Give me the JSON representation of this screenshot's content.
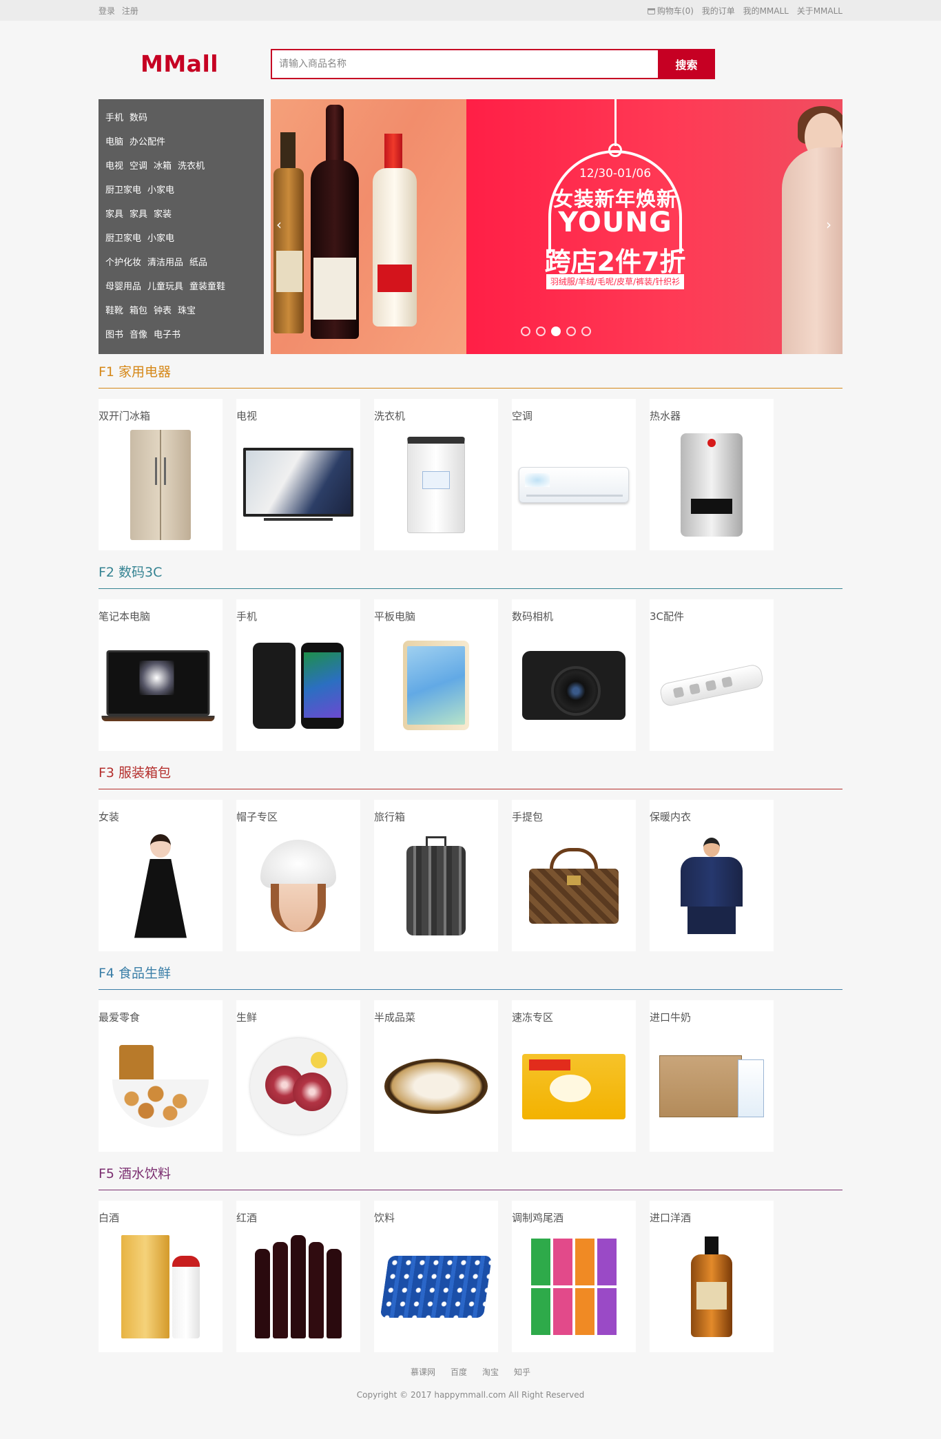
{
  "topnav": {
    "login": "登录",
    "register": "注册",
    "cart": "购物车(0)",
    "orders": "我的订单",
    "my_mmall": "我的MMALL",
    "about": "关于MMALL"
  },
  "header": {
    "logo": "MMall",
    "search_placeholder": "请输入商品名称",
    "search_button": "搜索"
  },
  "keywords": [
    [
      "手机",
      "数码"
    ],
    [
      "电脑",
      "办公配件"
    ],
    [
      "电视",
      "空调",
      "冰箱",
      "洗衣机"
    ],
    [
      "厨卫家电",
      "小家电"
    ],
    [
      "家具",
      "家具",
      "家装"
    ],
    [
      "厨卫家电",
      "小家电"
    ],
    [
      "个护化妆",
      "清洁用品",
      "纸品"
    ],
    [
      "母婴用品",
      "儿童玩具",
      "童装童鞋"
    ],
    [
      "鞋靴",
      "箱包",
      "钟表",
      "珠宝"
    ],
    [
      "图书",
      "音像",
      "电子书"
    ]
  ],
  "banner": {
    "date": "12/30-01/06",
    "line1": "女装新年焕新",
    "line2": "YOUNG",
    "line3": "跨店2件7折",
    "line4": "羽绒服/羊绒/毛呢/皮草/裤装/针织衫",
    "dots": 5,
    "active_dot": 3
  },
  "floors": [
    {
      "title": "F1 家用电器",
      "color": "#d58717",
      "items": [
        {
          "name": "双开门冰箱",
          "icon": "fridge-icon"
        },
        {
          "name": "电视",
          "icon": "tv-icon"
        },
        {
          "name": "洗衣机",
          "icon": "washer-icon"
        },
        {
          "name": "空调",
          "icon": "aircon-icon"
        },
        {
          "name": "热水器",
          "icon": "heater-icon"
        }
      ]
    },
    {
      "title": "F2 数码3C",
      "color": "#358392",
      "items": [
        {
          "name": "笔记本电脑",
          "icon": "laptop-icon"
        },
        {
          "name": "手机",
          "icon": "phone-icon"
        },
        {
          "name": "平板电脑",
          "icon": "tablet-icon"
        },
        {
          "name": "数码相机",
          "icon": "camera-icon"
        },
        {
          "name": "3C配件",
          "icon": "power-strip-icon"
        }
      ]
    },
    {
      "title": "F3 服装箱包",
      "color": "#b42e2c",
      "items": [
        {
          "name": "女装",
          "icon": "dress-icon"
        },
        {
          "name": "帽子专区",
          "icon": "hat-icon"
        },
        {
          "name": "旅行箱",
          "icon": "suitcase-icon"
        },
        {
          "name": "手提包",
          "icon": "handbag-icon"
        },
        {
          "name": "保暖内衣",
          "icon": "underwear-icon"
        }
      ]
    },
    {
      "title": "F4 食品生鲜",
      "color": "#3a7ea7",
      "items": [
        {
          "name": "最爱零食",
          "icon": "snack-icon"
        },
        {
          "name": "生鲜",
          "icon": "meat-icon"
        },
        {
          "name": "半成品菜",
          "icon": "dish-icon"
        },
        {
          "name": "速冻专区",
          "icon": "frozen-icon"
        },
        {
          "name": "进口牛奶",
          "icon": "milk-box-icon"
        }
      ]
    },
    {
      "title": "F5 酒水饮料",
      "color": "#7a2d6f",
      "items": [
        {
          "name": "白酒",
          "icon": "baijiu-icon"
        },
        {
          "name": "红酒",
          "icon": "red-wine-icon"
        },
        {
          "name": "饮料",
          "icon": "soda-cans-icon"
        },
        {
          "name": "调制鸡尾酒",
          "icon": "cocktail-cans-icon"
        },
        {
          "name": "进口洋酒",
          "icon": "whisky-icon"
        }
      ]
    }
  ],
  "footer": {
    "links": [
      "慕课网",
      "百度",
      "淘宝",
      "知乎"
    ],
    "copyright": "Copyright © 2017 happymmall.com All Right Reserved"
  }
}
